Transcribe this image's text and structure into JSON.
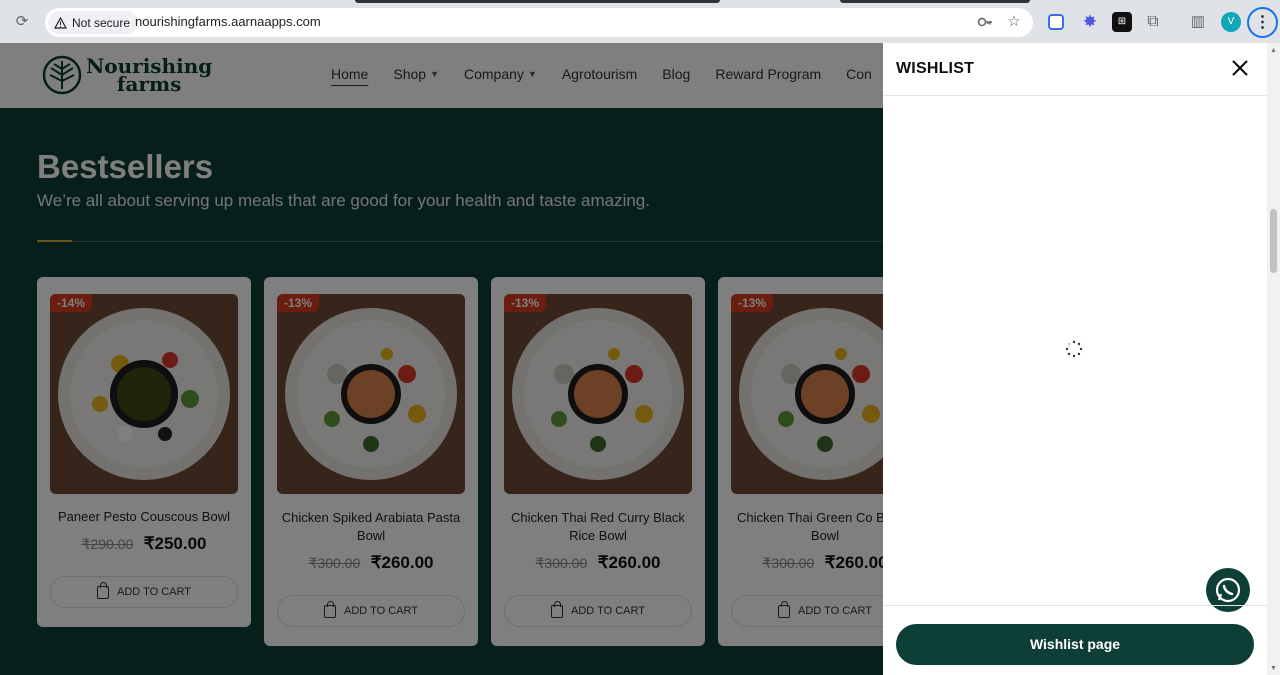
{
  "browser": {
    "security_label": "Not secure",
    "url": "nourishingfarms.aarnaapps.com",
    "profile_initial": "V"
  },
  "site": {
    "logo_line1": "Nourishing",
    "logo_line2": "farms",
    "nav": [
      {
        "label": "Home",
        "active": true,
        "dropdown": false
      },
      {
        "label": "Shop",
        "active": false,
        "dropdown": true
      },
      {
        "label": "Company",
        "active": false,
        "dropdown": true
      },
      {
        "label": "Agrotourism",
        "active": false,
        "dropdown": false
      },
      {
        "label": "Blog",
        "active": false,
        "dropdown": false
      },
      {
        "label": "Reward Program",
        "active": false,
        "dropdown": false
      },
      {
        "label": "Con",
        "active": false,
        "dropdown": false
      }
    ]
  },
  "bestsellers": {
    "title": "Bestsellers",
    "subtitle": "We’re all about serving up meals that are good for your health and taste amazing."
  },
  "products": [
    {
      "badge": "-14%",
      "name": "Paneer Pesto Couscous Bowl",
      "old_price": "₹290.00",
      "price": "₹250.00",
      "cart_label": "ADD TO CART",
      "sauce": "pesto"
    },
    {
      "badge": "-13%",
      "name": "Chicken Spiked Arabiata Pasta Bowl",
      "old_price": "₹300.00",
      "price": "₹260.00",
      "cart_label": "ADD TO CART",
      "sauce": "curry"
    },
    {
      "badge": "-13%",
      "name": "Chicken Thai Red Curry Black Rice Bowl",
      "old_price": "₹300.00",
      "price": "₹260.00",
      "cart_label": "ADD TO CART",
      "sauce": "curry"
    },
    {
      "badge": "-13%",
      "name": "Chicken Thai Green Co Barley Bowl",
      "old_price": "₹300.00",
      "price": "₹260.00",
      "cart_label": "ADD TO CART",
      "sauce": "curry"
    }
  ],
  "wishlist": {
    "title": "WISHLIST",
    "button_label": "Wishlist page"
  },
  "colors": {
    "brand_dark_green": "#0c3f37",
    "badge_red": "#d63b1f",
    "divider_accent": "#d7a63a"
  }
}
